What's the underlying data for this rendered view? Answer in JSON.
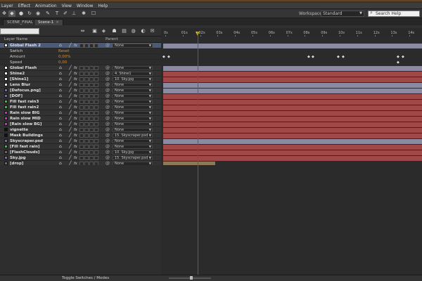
{
  "menu": [
    "Layer",
    "Effect",
    "Animation",
    "View",
    "Window",
    "Help"
  ],
  "toolbar": {
    "workspace_label": "Workspace:",
    "workspace_value": "Standard",
    "search_placeholder": "Search Help"
  },
  "tabs": [
    {
      "label": "SCENE_FINAL",
      "active": false
    },
    {
      "label": "Scene-1",
      "active": true
    }
  ],
  "ruler": {
    "ticks": [
      "0s",
      "01s",
      "02s",
      "03s",
      "04s",
      "05s",
      "06s",
      "07s",
      "08s",
      "09s",
      "10s",
      "11s",
      "12s",
      "13s",
      "14s"
    ]
  },
  "columns": {
    "layer_name": "Layer Name",
    "parent": "Parent"
  },
  "layers": [
    {
      "name": "Global Flash 2",
      "color": "#ffffff",
      "parent": "None",
      "selected": true,
      "bar": "#8a8aa0"
    },
    {
      "sub": true,
      "label": "Switch",
      "value": "Reset"
    },
    {
      "sub": true,
      "label": "Amount",
      "value": "0,00%"
    },
    {
      "sub": true,
      "label": "Speed",
      "value": "0,00"
    },
    {
      "name": "Global Flash",
      "color": "#ffffff",
      "parent": "None",
      "bar": "#8a8aa0"
    },
    {
      "name": "Shine2",
      "color": "#ffffff",
      "parent": "4. Shine1",
      "bar": "#a04848"
    },
    {
      "name": "[Shine1]",
      "color": "#ffffff",
      "parent": "10. Sky.jpg",
      "bar": "#a04848"
    },
    {
      "name": "Lens Blur",
      "color": "#ffffff",
      "parent": "None",
      "bar": "#8a8aa0"
    },
    {
      "name": "[Defocus.png]",
      "color": "#6a6ad0",
      "parent": "None",
      "bar": "#8a8aa0"
    },
    {
      "name": "[DOF]",
      "color": "#6a6ad0",
      "parent": "None",
      "bar": "#a04848"
    },
    {
      "name": "Fill fast rain3",
      "color": "#20d020",
      "parent": "None",
      "bar": "#a04848"
    },
    {
      "name": "Fill fast rain2",
      "color": "#20d020",
      "parent": "None",
      "bar": "#a04848"
    },
    {
      "name": "Rain slow BIG",
      "color": "#e020e0",
      "parent": "None",
      "bar": "#a04848"
    },
    {
      "name": "Rain slow MID",
      "color": "#e020e0",
      "parent": "None",
      "bar": "#a04848"
    },
    {
      "name": "[Rain slow BG]",
      "color": "#e020e0",
      "parent": "None",
      "bar": "#a04848"
    },
    {
      "name": "vignette",
      "color": "#111111",
      "parent": "None",
      "bar": "#a04848"
    },
    {
      "name": "Mask Buildings",
      "color": "#111111",
      "parent": "15. Skyscraper.psd",
      "bar": "#a04848"
    },
    {
      "name": "Skyscraper.psd",
      "color": "#6a6ad0",
      "parent": "None",
      "bar": "#8a8aa0"
    },
    {
      "name": "[Fill fast rain]",
      "color": "#20d020",
      "parent": "None",
      "bar": "#a04848"
    },
    {
      "name": "[FlashClouds]",
      "color": "#6a6a6a",
      "parent": "10. Sky.jpg",
      "bar": "#a04848"
    },
    {
      "name": "Sky.jpg",
      "color": "#6a6ad0",
      "parent": "15. Skyscraper.psd",
      "bar": "#a04848"
    },
    {
      "name": "[drop]",
      "color": "#6a6a6a",
      "parent": "None",
      "bar": "#8a7a5a"
    }
  ],
  "bottom": {
    "toggle_label": "Toggle Switches / Modes"
  }
}
